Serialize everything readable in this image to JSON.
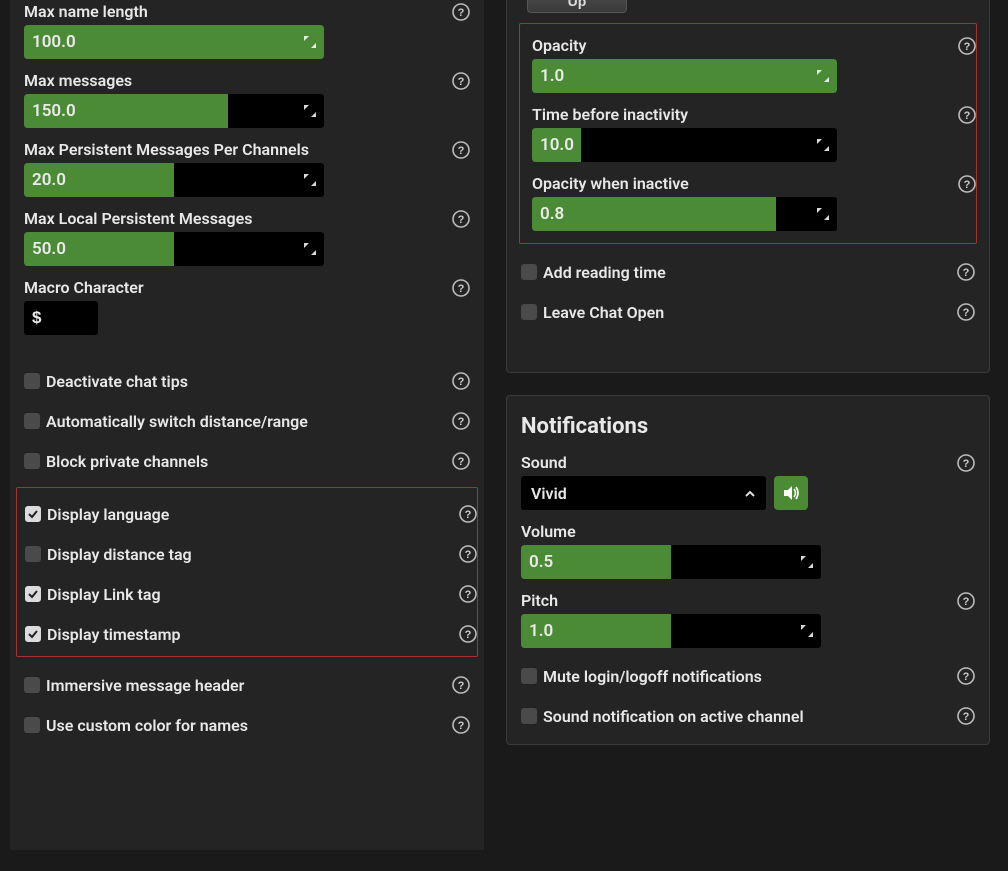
{
  "left": {
    "max_name_length_label": "Max name length",
    "max_name_length_value": "100.0",
    "max_name_length_fill": 100,
    "max_messages_label": "Max messages",
    "max_messages_value": "150.0",
    "max_messages_fill": 68,
    "max_persist_label": "Max Persistent Messages Per Channels",
    "max_persist_value": "20.0",
    "max_persist_fill": 50,
    "max_local_persist_label": "Max Local Persistent Messages",
    "max_local_persist_value": "50.0",
    "max_local_persist_fill": 50,
    "macro_label": "Macro Character",
    "macro_value": "$",
    "chk_deactivate": "Deactivate chat tips",
    "chk_autoswitch": "Automatically switch distance/range",
    "chk_blockpriv": "Block private channels",
    "chk_displang": "Display language",
    "chk_dispdist": "Display distance tag",
    "chk_displink": "Display Link tag",
    "chk_dispts": "Display timestamp",
    "chk_immersive": "Immersive message header",
    "chk_customcolor": "Use custom color for names"
  },
  "right": {
    "btn_up": "Up",
    "opacity_label": "Opacity",
    "opacity_value": "1.0",
    "opacity_fill": 100,
    "inact_label": "Time before inactivity",
    "inact_value": "10.0",
    "inact_fill": 16,
    "opinact_label": "Opacity when inactive",
    "opinact_value": "0.8",
    "opinact_fill": 80,
    "chk_readtime": "Add reading time",
    "chk_leaveopen": "Leave Chat Open",
    "notif_title": "Notifications",
    "sound_label": "Sound",
    "sound_value": "Vivid",
    "volume_label": "Volume",
    "volume_value": "0.5",
    "volume_fill": 50,
    "pitch_label": "Pitch",
    "pitch_value": "1.0",
    "pitch_fill": 50,
    "chk_mute": "Mute login/logoff notifications",
    "chk_soundactive": "Sound notification on active channel"
  }
}
